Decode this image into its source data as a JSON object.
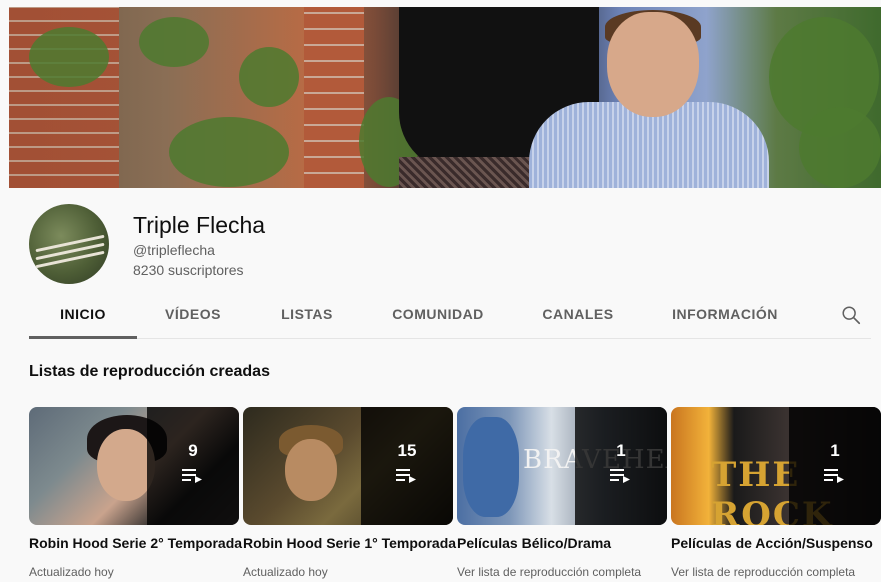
{
  "channel": {
    "name": "Triple Flecha",
    "handle": "@tripleflecha",
    "subscribers": "8230 suscriptores"
  },
  "tabs": [
    {
      "label": "INICIO",
      "active": true
    },
    {
      "label": "VÍDEOS",
      "active": false
    },
    {
      "label": "LISTAS",
      "active": false
    },
    {
      "label": "COMUNIDAD",
      "active": false
    },
    {
      "label": "CANALES",
      "active": false
    },
    {
      "label": "INFORMACIÓN",
      "active": false
    }
  ],
  "section": {
    "title": "Listas de reproducción creadas"
  },
  "playlists": [
    {
      "title": "Robin Hood Serie 2° Temporada",
      "count": "9",
      "subtitle": "Actualizado hoy"
    },
    {
      "title": "Robin Hood Serie 1° Temporada",
      "count": "15",
      "subtitle": "Actualizado hoy"
    },
    {
      "title": "Películas Bélico/Drama",
      "count": "1",
      "subtitle": "Ver lista de reproducción completa",
      "thumb_text": "BRAVEHEART"
    },
    {
      "title": "Películas de Acción/Suspenso",
      "count": "1",
      "subtitle": "Ver lista de reproducción completa",
      "thumb_text": "THE ROCK"
    }
  ],
  "icons": {
    "search": "search-icon",
    "playlist": "playlist-icon"
  },
  "colors": {
    "background": "#f9f9f9",
    "text_primary": "#0f0f0f",
    "text_secondary": "#606060",
    "tab_indicator": "#606060"
  }
}
